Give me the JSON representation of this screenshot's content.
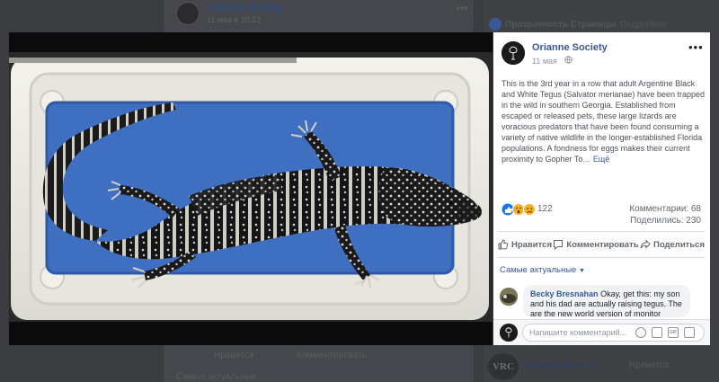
{
  "background": {
    "top_post_author": "Orianne Society",
    "top_post_date": "11 мая в 20:12",
    "right_column_title": "Прозрачность Страницы",
    "right_column_link": "Подробнее",
    "bottom_like": "Нравится",
    "bottom_comment": "Комментировать",
    "bottom_sort": "Самые актуальные",
    "suggested_page_logo_text": "VRC",
    "suggested_page_name": "Vermont River C...",
    "suggested_page_like": "Нравится"
  },
  "post": {
    "author": "Orianne Society",
    "date": "11 мая",
    "privacy_icon": "globe-icon",
    "more_icon": "more-dots-icon",
    "text": "This is the 3rd year in a row that adult Argentine Black and White Tegus (Salvator merianae) have been trapped in the wild in southern Georgia. Established from escaped or released pets, these large lizards are voracious predators that have been found consuming a variety of native wildlife in the longer-established Florida populations. A fondness for eggs makes their current proximity to Gopher To…",
    "see_more": "Ещё",
    "reactions_count": "122",
    "comments_count": "Комментарии: 68",
    "shares_count": "Поделились: 230"
  },
  "actions": {
    "like": "Нравится",
    "comment": "Комментировать",
    "share": "Поделиться"
  },
  "comments": {
    "sort_label": "Самые актуальные",
    "items": [
      {
        "author": "Becky Bresnahan",
        "text": "Okay, get this: my son and his dad are actually raising tegus. The are the new world version of monitor lizards."
      }
    ]
  },
  "composer": {
    "placeholder": "Напишите комментарий...",
    "icons": [
      "emoji-icon",
      "camera-icon",
      "gif-icon",
      "sticker-icon"
    ]
  },
  "colors": {
    "link_blue": "#385898",
    "facebook_blue": "#3b5998",
    "tray_blue": "#3f6fc0",
    "tray_white": "#ecebe4"
  }
}
